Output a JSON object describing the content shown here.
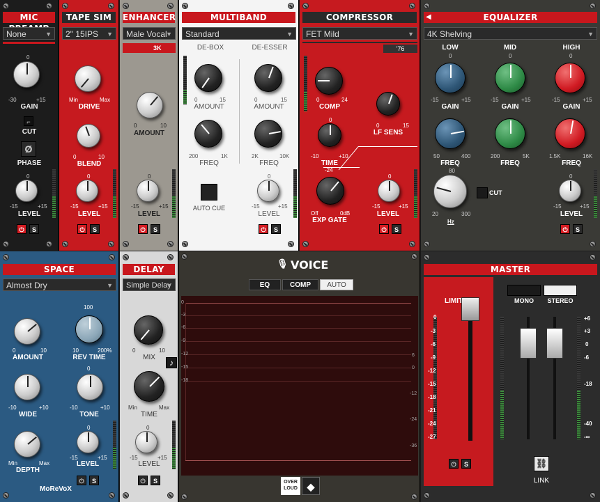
{
  "mic": {
    "title": "MIC PREAMP",
    "preset": "None",
    "gain_min": "-30",
    "gain_max": "+15",
    "gain_top": "0",
    "gain": "GAIN",
    "cut": "CUT",
    "phase": "PHASE",
    "phase_glyph": "Ø",
    "lvl_min": "-15",
    "lvl_max": "+15",
    "lvl_top": "0",
    "level": "LEVEL",
    "s": "S"
  },
  "tape": {
    "title": "TAPE SIM",
    "preset": "2\" 15IPS",
    "drive_min": "Min",
    "drive_max": "Max",
    "drive": "DRIVE",
    "blend_min": "0",
    "blend_max": "10",
    "blend": "BLEND",
    "lvl_min": "-15",
    "lvl_max": "+15",
    "lvl_top": "0",
    "level": "LEVEL",
    "s": "S"
  },
  "enh": {
    "title": "ENHANCER",
    "preset": "Male Vocal",
    "freq": "3K",
    "amt_min": "0",
    "amt_max": "10",
    "amount": "AMOUNT",
    "lvl_min": "-15",
    "lvl_max": "+15",
    "lvl_top": "0",
    "level": "LEVEL",
    "s": "S"
  },
  "mb": {
    "title": "MULTIBAND",
    "preset": "Standard",
    "debox": "DE-BOX",
    "deesser": "DE-ESSER",
    "amt1_min": "0",
    "amt1_max": "15",
    "amount1": "AMOUNT",
    "amt2_min": "0",
    "amt2_max": "15",
    "amount2": "AMOUNT",
    "f1_min": "200",
    "f1_max": "1K",
    "freq1": "FREQ",
    "f2_min": "2K",
    "f2_max": "10K",
    "freq2": "FREQ",
    "autocue": "AUTO CUE",
    "lvl_min": "-15",
    "lvl_max": "+15",
    "lvl_top": "0",
    "level": "LEVEL",
    "s": "S"
  },
  "comp": {
    "title": "COMPRESSOR",
    "preset": "FET Mild",
    "badge": "'76",
    "comp": "COMP",
    "comp_min": "0",
    "comp_max": "24",
    "lf": "LF SENS",
    "lf_min": "0",
    "lf_max": "15",
    "time": "TIME",
    "time_min": "-10",
    "time_max": "+10",
    "time_top": "0",
    "gate": "EXP GATE",
    "gate_top": "-24",
    "gate_min": "Off",
    "gate_max": "0dB",
    "lvl_min": "-15",
    "lvl_max": "+15",
    "lvl_top": "0",
    "level": "LEVEL",
    "s": "S"
  },
  "eq": {
    "title": "EQUALIZER",
    "preset": "4K Shelving",
    "low": "LOW",
    "mid": "MID",
    "high": "HIGH",
    "g_min": "-15",
    "g_max": "+15",
    "g_top": "0",
    "gain": "GAIN",
    "fl_min": "50",
    "fl_max": "400",
    "fm_min": "200",
    "fm_max": "5K",
    "fh_min": "1.5K",
    "fh_max": "16K",
    "freq": "FREQ",
    "hp_top": "80",
    "hp_min": "20",
    "hp_max": "300",
    "hz": "Hz",
    "cut": "CUT",
    "lvl_min": "-15",
    "lvl_max": "+15",
    "lvl_top": "0",
    "level": "LEVEL",
    "s": "S"
  },
  "space": {
    "title": "SPACE",
    "preset": "Almost Dry",
    "amount": "AMOUNT",
    "amt_min": "0",
    "amt_max": "10",
    "rev": "REV TIME",
    "rev_top": "100",
    "rev_min": "10",
    "rev_max": "200%",
    "wide": "WIDE",
    "wide_min": "-10",
    "wide_max": "+10",
    "tone": "TONE",
    "tone_top": "0",
    "tone_min": "-10",
    "tone_max": "+10",
    "depth": "DEPTH",
    "depth_min": "Min",
    "depth_max": "Max",
    "level": "LEVEL",
    "lvl_top": "0",
    "lvl_min": "-15",
    "lvl_max": "+15",
    "brand": "MoReVoX",
    "s": "S"
  },
  "delay": {
    "title": "DELAY",
    "preset": "Simple Delay",
    "mix": "MIX",
    "mix_min": "0",
    "mix_max": "10",
    "time": "TIME",
    "time_min": "Min",
    "time_max": "Max",
    "note": "♪",
    "level": "LEVEL",
    "lvl_top": "0",
    "lvl_min": "-15",
    "lvl_max": "+15",
    "s": "S"
  },
  "voice": {
    "title": "VOICE",
    "tab_eq": "EQ",
    "tab_comp": "COMP",
    "tab_auto": "AUTO",
    "left_ticks": [
      "0",
      "-3",
      "-6",
      "-9",
      "-12",
      "-15",
      "-18"
    ],
    "right_ticks": [
      "6",
      "0",
      "-12",
      "-24",
      "-36"
    ],
    "logo": "OVER LOUD"
  },
  "master": {
    "title": "MASTER",
    "limiter": "LIMITER",
    "mono": "MONO",
    "stereo": "STEREO",
    "ticks_l": [
      "0",
      "-3",
      "-6",
      "-9",
      "-12",
      "-15",
      "-18",
      "-21",
      "-24",
      "-27"
    ],
    "ticks_r": [
      "+6",
      "+3",
      "0",
      "-6",
      "-18",
      "-40",
      "-∞"
    ],
    "link": "LINK",
    "s": "S"
  }
}
